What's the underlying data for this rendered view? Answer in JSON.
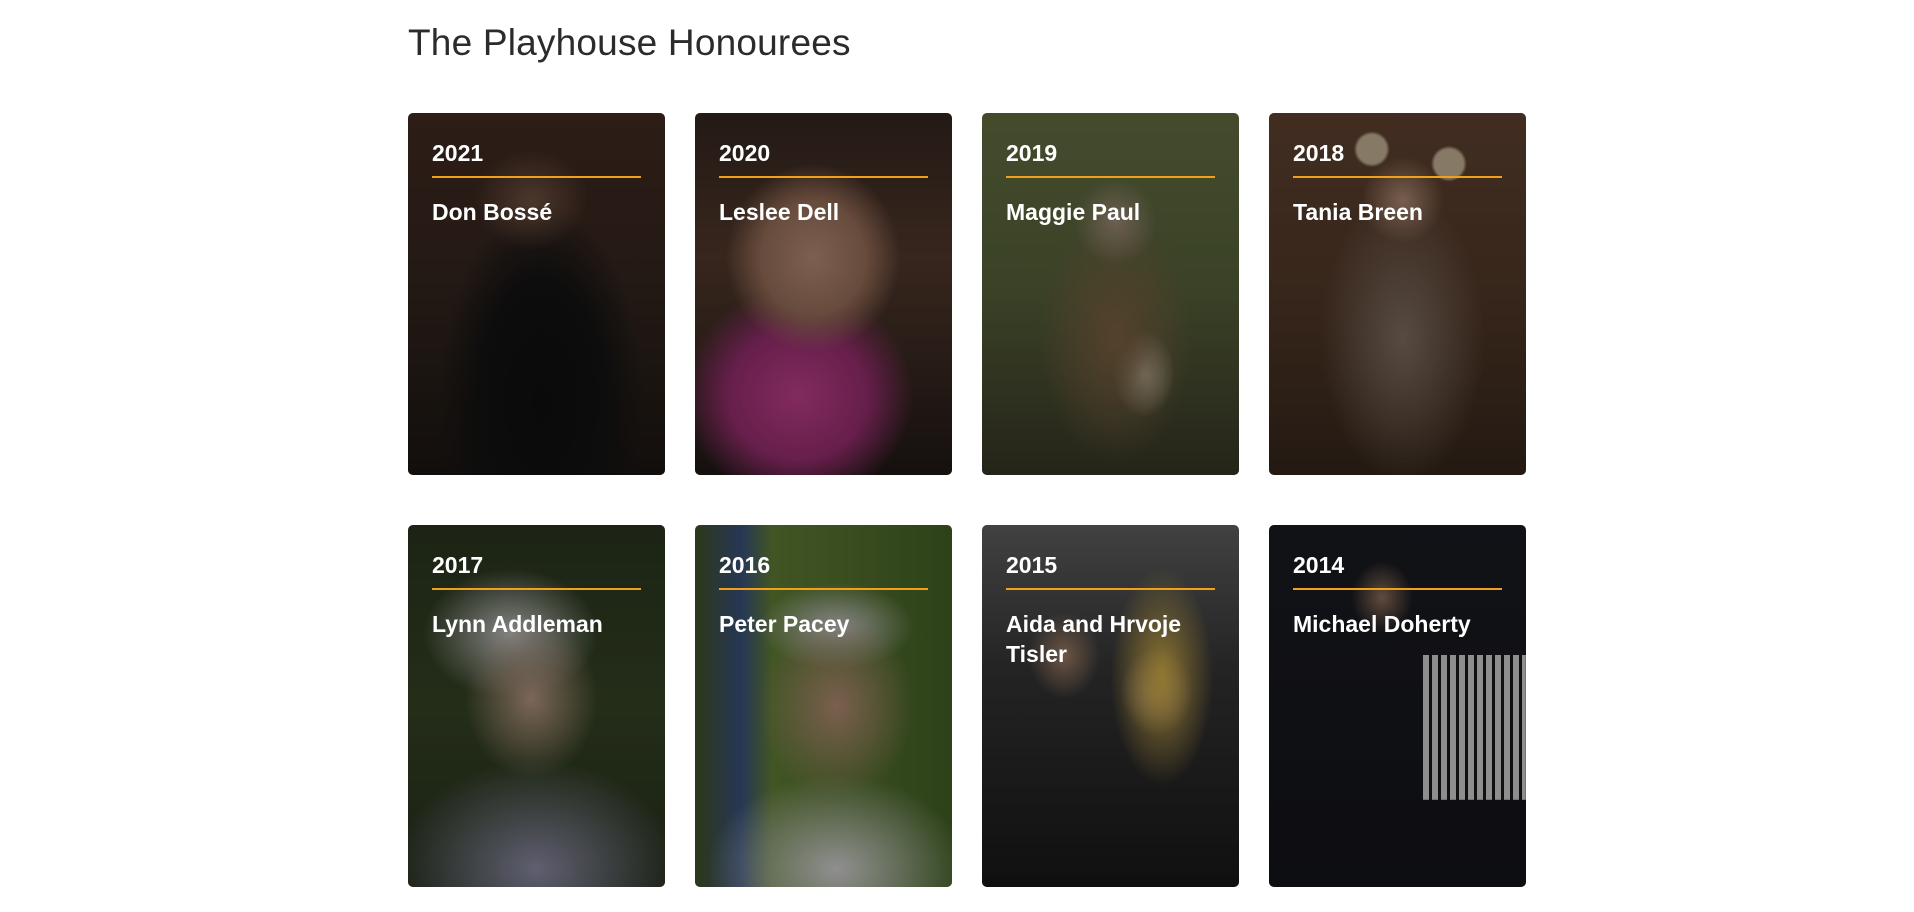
{
  "section": {
    "title": "The Playhouse Honourees"
  },
  "cards": [
    {
      "year": "2021",
      "name": "Don Bossé"
    },
    {
      "year": "2020",
      "name": "Leslee Dell"
    },
    {
      "year": "2019",
      "name": "Maggie Paul"
    },
    {
      "year": "2018",
      "name": "Tania Breen"
    },
    {
      "year": "2017",
      "name": "Lynn Addleman"
    },
    {
      "year": "2016",
      "name": "Peter Pacey"
    },
    {
      "year": "2015",
      "name": "Aida and Hrvoje Tisler"
    },
    {
      "year": "2014",
      "name": "Michael Doherty"
    }
  ],
  "colors": {
    "accent": "#f0a019",
    "card_text": "#ffffff",
    "heading_text": "#2b2b2b"
  }
}
